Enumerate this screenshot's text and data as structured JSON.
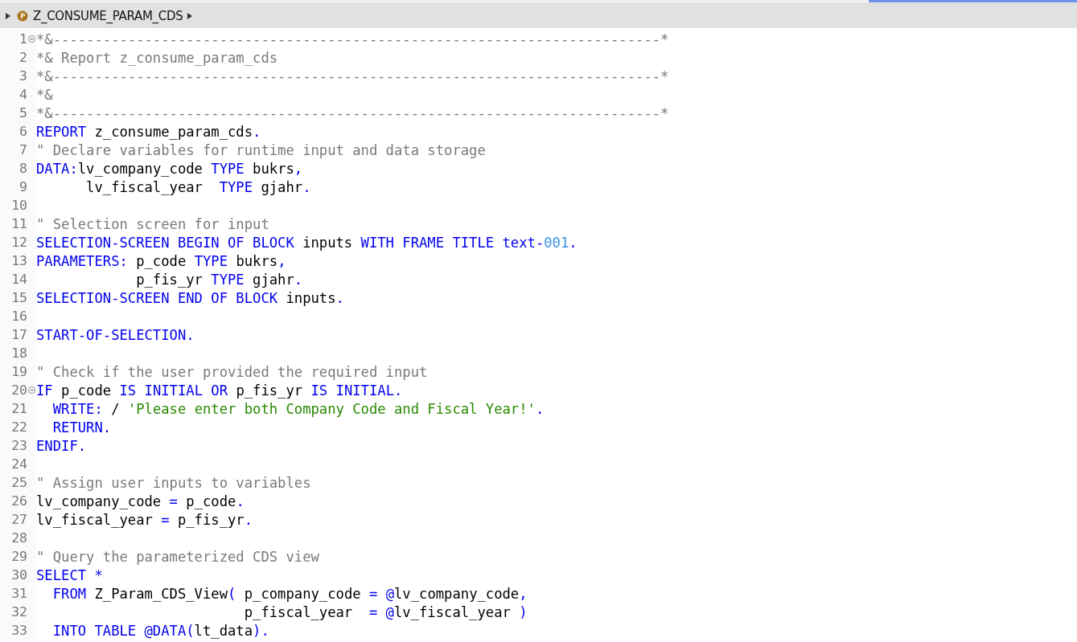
{
  "breadcrumb": {
    "title": "Z_CONSUME_PARAM_CDS"
  },
  "lines": [
    {
      "no": "1",
      "fold_marker": true,
      "tokens": [
        {
          "kind": "comment",
          "t": "*&-------------------------------------------------------------------------*"
        }
      ]
    },
    {
      "no": "2",
      "fold_marker": false,
      "tokens": [
        {
          "kind": "comment",
          "t": "*& Report z_consume_param_cds"
        }
      ]
    },
    {
      "no": "3",
      "fold_marker": false,
      "tokens": [
        {
          "kind": "comment",
          "t": "*&-------------------------------------------------------------------------*"
        }
      ]
    },
    {
      "no": "4",
      "fold_marker": false,
      "tokens": [
        {
          "kind": "comment",
          "t": "*&"
        }
      ]
    },
    {
      "no": "5",
      "fold_marker": false,
      "tokens": [
        {
          "kind": "comment",
          "t": "*&-------------------------------------------------------------------------*"
        }
      ]
    },
    {
      "no": "6",
      "fold_marker": false,
      "tokens": [
        {
          "kind": "kw",
          "t": "REPORT"
        },
        {
          "kind": "plain",
          "t": " z_consume_param_cds"
        },
        {
          "kind": "kw",
          "t": "."
        }
      ]
    },
    {
      "no": "7",
      "fold_marker": false,
      "tokens": [
        {
          "kind": "comment",
          "t": "\" Declare variables for runtime input and data storage"
        }
      ]
    },
    {
      "no": "8",
      "fold_marker": false,
      "tokens": [
        {
          "kind": "kw",
          "t": "DATA:"
        },
        {
          "kind": "plain",
          "t": "lv_company_code "
        },
        {
          "kind": "kw",
          "t": "TYPE"
        },
        {
          "kind": "plain",
          "t": " bukrs"
        },
        {
          "kind": "kw",
          "t": ","
        }
      ]
    },
    {
      "no": "9",
      "fold_marker": false,
      "tokens": [
        {
          "kind": "plain",
          "t": "      lv_fiscal_year  "
        },
        {
          "kind": "kw",
          "t": "TYPE"
        },
        {
          "kind": "plain",
          "t": " gjahr"
        },
        {
          "kind": "kw",
          "t": "."
        }
      ]
    },
    {
      "no": "10",
      "fold_marker": false
    },
    {
      "no": "11",
      "fold_marker": false,
      "tokens": [
        {
          "kind": "comment",
          "t": "\" Selection screen for input"
        }
      ]
    },
    {
      "no": "12",
      "fold_marker": false,
      "tokens": [
        {
          "kind": "kw",
          "t": "SELECTION-SCREEN BEGIN OF BLOCK"
        },
        {
          "kind": "plain",
          "t": " inputs "
        },
        {
          "kind": "kw",
          "t": "WITH FRAME TITLE text-"
        },
        {
          "kind": "num",
          "t": "001"
        },
        {
          "kind": "kw",
          "t": "."
        }
      ]
    },
    {
      "no": "13",
      "fold_marker": false,
      "tokens": [
        {
          "kind": "kw",
          "t": "PARAMETERS:"
        },
        {
          "kind": "plain",
          "t": " p_code "
        },
        {
          "kind": "kw",
          "t": "TYPE"
        },
        {
          "kind": "plain",
          "t": " bukrs"
        },
        {
          "kind": "kw",
          "t": ","
        }
      ]
    },
    {
      "no": "14",
      "fold_marker": false,
      "tokens": [
        {
          "kind": "plain",
          "t": "            p_fis_yr "
        },
        {
          "kind": "kw",
          "t": "TYPE"
        },
        {
          "kind": "plain",
          "t": " gjahr"
        },
        {
          "kind": "kw",
          "t": "."
        }
      ]
    },
    {
      "no": "15",
      "fold_marker": false,
      "tokens": [
        {
          "kind": "kw",
          "t": "SELECTION-SCREEN END OF BLOCK"
        },
        {
          "kind": "plain",
          "t": " inputs"
        },
        {
          "kind": "kw",
          "t": "."
        }
      ]
    },
    {
      "no": "16",
      "fold_marker": false
    },
    {
      "no": "17",
      "fold_marker": false,
      "tokens": [
        {
          "kind": "kw",
          "t": "START-OF-SELECTION."
        }
      ]
    },
    {
      "no": "18",
      "fold_marker": false
    },
    {
      "no": "19",
      "fold_marker": false,
      "tokens": [
        {
          "kind": "comment",
          "t": "\" Check if the user provided the required input"
        }
      ]
    },
    {
      "no": "20",
      "fold_marker": true,
      "tokens": [
        {
          "kind": "kw",
          "t": "IF"
        },
        {
          "kind": "plain",
          "t": " p_code "
        },
        {
          "kind": "kw",
          "t": "IS INITIAL OR"
        },
        {
          "kind": "plain",
          "t": " p_fis_yr "
        },
        {
          "kind": "kw",
          "t": "IS INITIAL."
        }
      ]
    },
    {
      "no": "21",
      "fold_marker": false,
      "tokens": [
        {
          "kind": "kw",
          "t": "  WRITE:"
        },
        {
          "kind": "plain",
          "t": " / "
        },
        {
          "kind": "str",
          "t": "'Please enter both Company Code and Fiscal Year!'"
        },
        {
          "kind": "kw",
          "t": "."
        }
      ]
    },
    {
      "no": "22",
      "fold_marker": false,
      "tokens": [
        {
          "kind": "kw",
          "t": "  RETURN."
        }
      ]
    },
    {
      "no": "23",
      "fold_marker": false,
      "tokens": [
        {
          "kind": "kw",
          "t": "ENDIF."
        }
      ]
    },
    {
      "no": "24",
      "fold_marker": false
    },
    {
      "no": "25",
      "fold_marker": false,
      "tokens": [
        {
          "kind": "comment",
          "t": "\" Assign user inputs to variables"
        }
      ]
    },
    {
      "no": "26",
      "fold_marker": false,
      "tokens": [
        {
          "kind": "plain",
          "t": "lv_company_code "
        },
        {
          "kind": "kw",
          "t": "="
        },
        {
          "kind": "plain",
          "t": " p_code"
        },
        {
          "kind": "kw",
          "t": "."
        }
      ]
    },
    {
      "no": "27",
      "fold_marker": false,
      "tokens": [
        {
          "kind": "plain",
          "t": "lv_fiscal_year "
        },
        {
          "kind": "kw",
          "t": "="
        },
        {
          "kind": "plain",
          "t": " p_fis_yr"
        },
        {
          "kind": "kw",
          "t": "."
        }
      ]
    },
    {
      "no": "28",
      "fold_marker": false
    },
    {
      "no": "29",
      "fold_marker": false,
      "tokens": [
        {
          "kind": "comment",
          "t": "\" Query the parameterized CDS view"
        }
      ]
    },
    {
      "no": "30",
      "fold_marker": false,
      "tokens": [
        {
          "kind": "kw",
          "t": "SELECT *"
        }
      ]
    },
    {
      "no": "31",
      "fold_marker": false,
      "tokens": [
        {
          "kind": "kw",
          "t": "  FROM"
        },
        {
          "kind": "plain",
          "t": " Z_Param_CDS_View"
        },
        {
          "kind": "kw",
          "t": "("
        },
        {
          "kind": "plain",
          "t": " p_company_code "
        },
        {
          "kind": "kw",
          "t": "= @"
        },
        {
          "kind": "plain",
          "t": "lv_company_code"
        },
        {
          "kind": "kw",
          "t": ","
        }
      ]
    },
    {
      "no": "32",
      "fold_marker": false,
      "tokens": [
        {
          "kind": "plain",
          "t": "                         p_fiscal_year  "
        },
        {
          "kind": "kw",
          "t": "= @"
        },
        {
          "kind": "plain",
          "t": "lv_fiscal_year "
        },
        {
          "kind": "kw",
          "t": ")"
        }
      ]
    },
    {
      "no": "33",
      "fold_marker": false,
      "tokens": [
        {
          "kind": "kw",
          "t": "  INTO TABLE @DATA("
        },
        {
          "kind": "plain",
          "t": "lt_data"
        },
        {
          "kind": "kw",
          "t": ")."
        }
      ]
    }
  ]
}
